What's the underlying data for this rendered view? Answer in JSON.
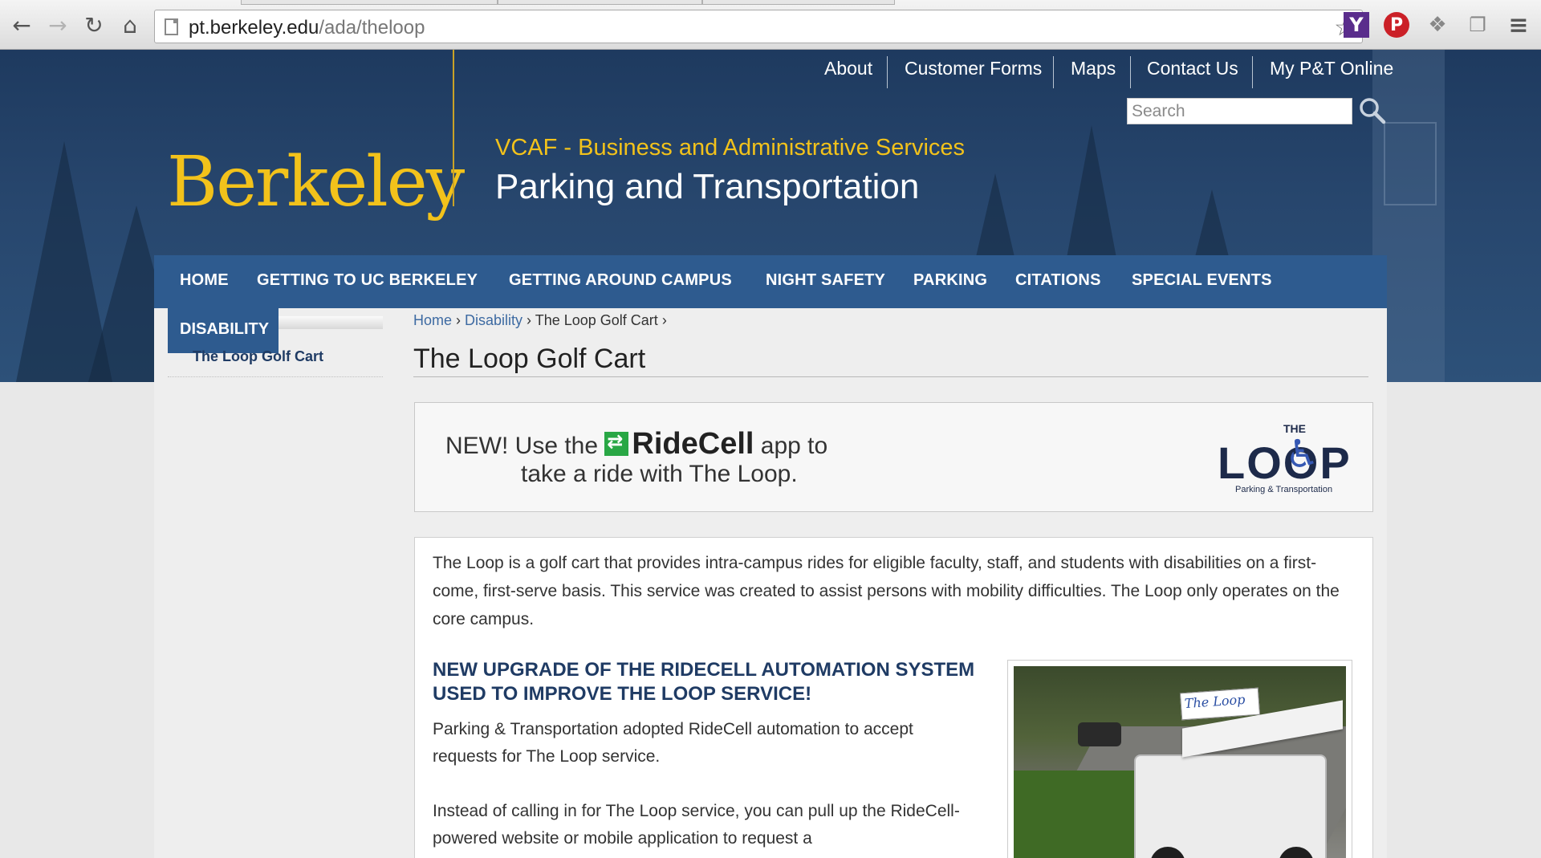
{
  "browser": {
    "url_domain": "pt.berkeley.edu",
    "url_path": "/ada/theloop"
  },
  "utility_nav": [
    "About",
    "Customer Forms",
    "Maps",
    "Contact Us",
    "My P&T Online"
  ],
  "search": {
    "placeholder": "Search"
  },
  "brand": {
    "logo": "Berkeley",
    "org": "VCAF - Business and Administrative Services",
    "site_title": "Parking and Transportation"
  },
  "main_nav": [
    "HOME",
    "GETTING TO UC BERKELEY",
    "GETTING AROUND CAMPUS",
    "NIGHT SAFETY",
    "PARKING",
    "CITATIONS",
    "SPECIAL EVENTS"
  ],
  "sidebar": {
    "section": "DISABILITY",
    "items": [
      "The Loop Golf Cart"
    ]
  },
  "breadcrumb": {
    "home": "Home",
    "section": "Disability",
    "current": "The Loop Golf Cart"
  },
  "page_title": "The Loop Golf Cart",
  "banner": {
    "prefix": "NEW! Use the",
    "brand": "RideCell",
    "suffix": "app to",
    "line2": "take a ride with The Loop.",
    "logo_the": "THE",
    "logo_word": "LOOP",
    "logo_sub": "Parking & Transportation"
  },
  "article": {
    "intro": "The Loop is a golf cart that provides intra-campus rides for eligible faculty, staff, and students with disabilities on a first-come, first-serve basis. This service was created to assist persons with mobility difficulties. The Loop only operates on the core campus.",
    "heading": "NEW UPGRADE OF THE RIDECELL AUTOMATION SYSTEM USED TO IMPROVE THE LOOP SERVICE!",
    "p1": "Parking & Transportation adopted RideCell automation to accept requests for The Loop service.",
    "p2": "Instead of calling in for The Loop service, you can pull up the RideCell-powered website or mobile application to request a",
    "photo_sign": "The Loop"
  },
  "colors": {
    "header_bg": "#27466d",
    "nav_bg": "#2e5b8f",
    "gold": "#f2c21b",
    "heading_blue": "#1f3b64"
  },
  "icons": [
    "back-icon",
    "forward-icon",
    "reload-icon",
    "home-icon",
    "page-icon",
    "star-icon",
    "yahoo-icon",
    "pinterest-icon",
    "dropbox-icon",
    "pages-icon",
    "menu-icon",
    "search-icon",
    "wheelchair-icon",
    "ridecell-icon"
  ]
}
